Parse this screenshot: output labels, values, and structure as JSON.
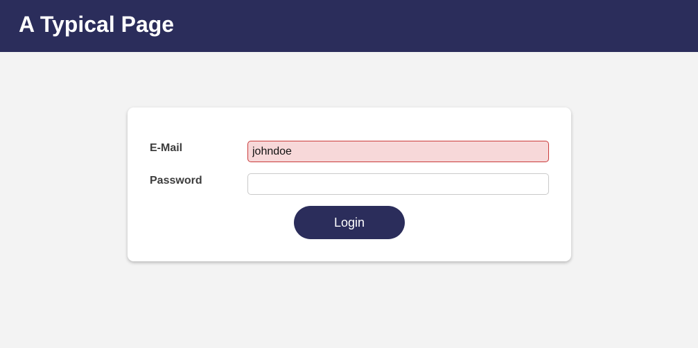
{
  "header": {
    "title": "A Typical Page"
  },
  "login_form": {
    "email": {
      "label": "E-Mail",
      "value": "johndoe",
      "state": "invalid"
    },
    "password": {
      "label": "Password",
      "value": ""
    },
    "submit_label": "Login"
  },
  "colors": {
    "brand": "#2b2d5b",
    "background": "#f3f3f3",
    "error_fill": "#f7d8d9",
    "error_border": "#c93a3a"
  }
}
